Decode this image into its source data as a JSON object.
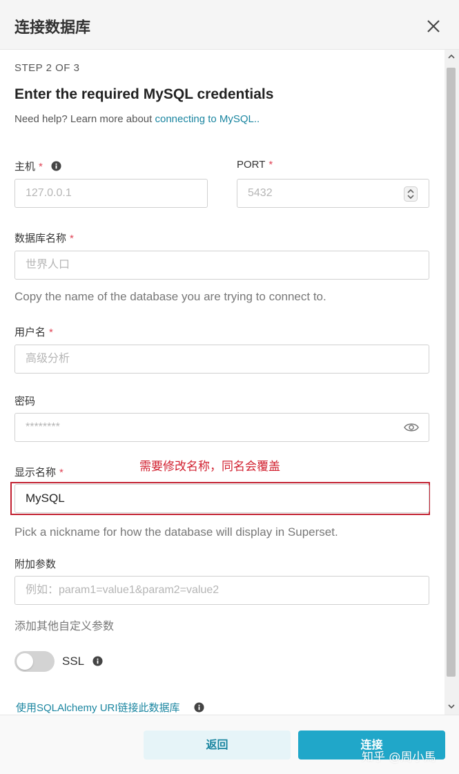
{
  "dialog": {
    "title": "连接数据库"
  },
  "form": {
    "step": "STEP 2 OF 3",
    "heading": "Enter the required MySQL credentials",
    "help_prefix": "Need help? Learn more about ",
    "help_link": "connecting to MySQL..",
    "host": {
      "label": "主机",
      "placeholder": "127.0.0.1"
    },
    "port": {
      "label": "PORT",
      "placeholder": "5432"
    },
    "database_name": {
      "label": "数据库名称",
      "placeholder": "世界人口",
      "hint": "Copy the name of the database you are trying to connect to."
    },
    "username": {
      "label": "用户名",
      "placeholder": "高级分析"
    },
    "password": {
      "label": "密码",
      "placeholder": "********"
    },
    "display_name": {
      "label": "显示名称",
      "value": "MySQL",
      "hint": "Pick a nickname for how the database will display in Superset."
    },
    "extra_params": {
      "label": "附加参数",
      "placeholder": "例如：param1=value1&param2=value2",
      "hint": "添加其他自定义参数"
    },
    "ssl": {
      "label": "SSL",
      "enabled": false
    },
    "sqlalchemy_link": "使用SQLAlchemy URI链接此数据库",
    "required_mark": "*"
  },
  "annotation": {
    "text": "需要修改名称，同名会覆盖",
    "color": "#d11f2e"
  },
  "footer": {
    "back_label": "返回",
    "connect_label": "连接"
  },
  "watermark": "知乎 @周小馬",
  "colors": {
    "accent": "#20a7c9",
    "link": "#1a85a0",
    "required": "#e04355"
  }
}
